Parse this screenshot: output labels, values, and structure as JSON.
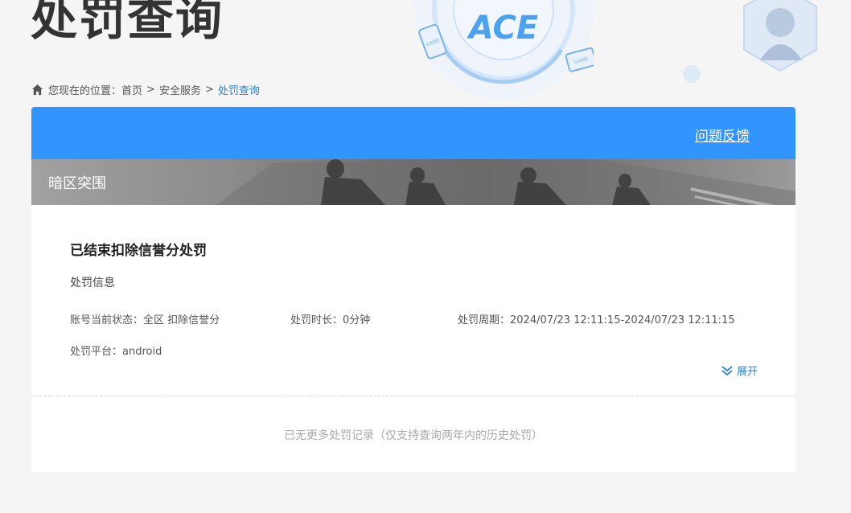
{
  "header": {
    "title": "处罚查询",
    "logo_text": "ACE",
    "deco_tag_1": "GAME",
    "deco_tag_2": "GAME"
  },
  "breadcrumb": {
    "prefix": "您现在的位置：",
    "home": "首页",
    "separator": ">",
    "section": "安全服务",
    "current": "处罚查询"
  },
  "card": {
    "feedback_label": "问题反馈",
    "game_name": "暗区突围",
    "record": {
      "title": "已结束扣除信誉分处罚",
      "section_label": "处罚信息",
      "status_key": "账号当前状态：",
      "status_value": "全区 扣除信誉分",
      "duration_key": "处罚时长：",
      "duration_value": "0分钟",
      "period_key": "处罚周期：",
      "period_value": "2024/07/23 12:11:15-2024/07/23 12:11:15",
      "platform_key": "处罚平台：",
      "platform_value": "android",
      "expand_label": "展开"
    },
    "no_more_text": "已无更多处罚记录（仅支持查询两年内的历史处罚）"
  },
  "colors": {
    "accent": "#3294ff",
    "link": "#2f7fd8",
    "background": "#f5f5f5"
  }
}
